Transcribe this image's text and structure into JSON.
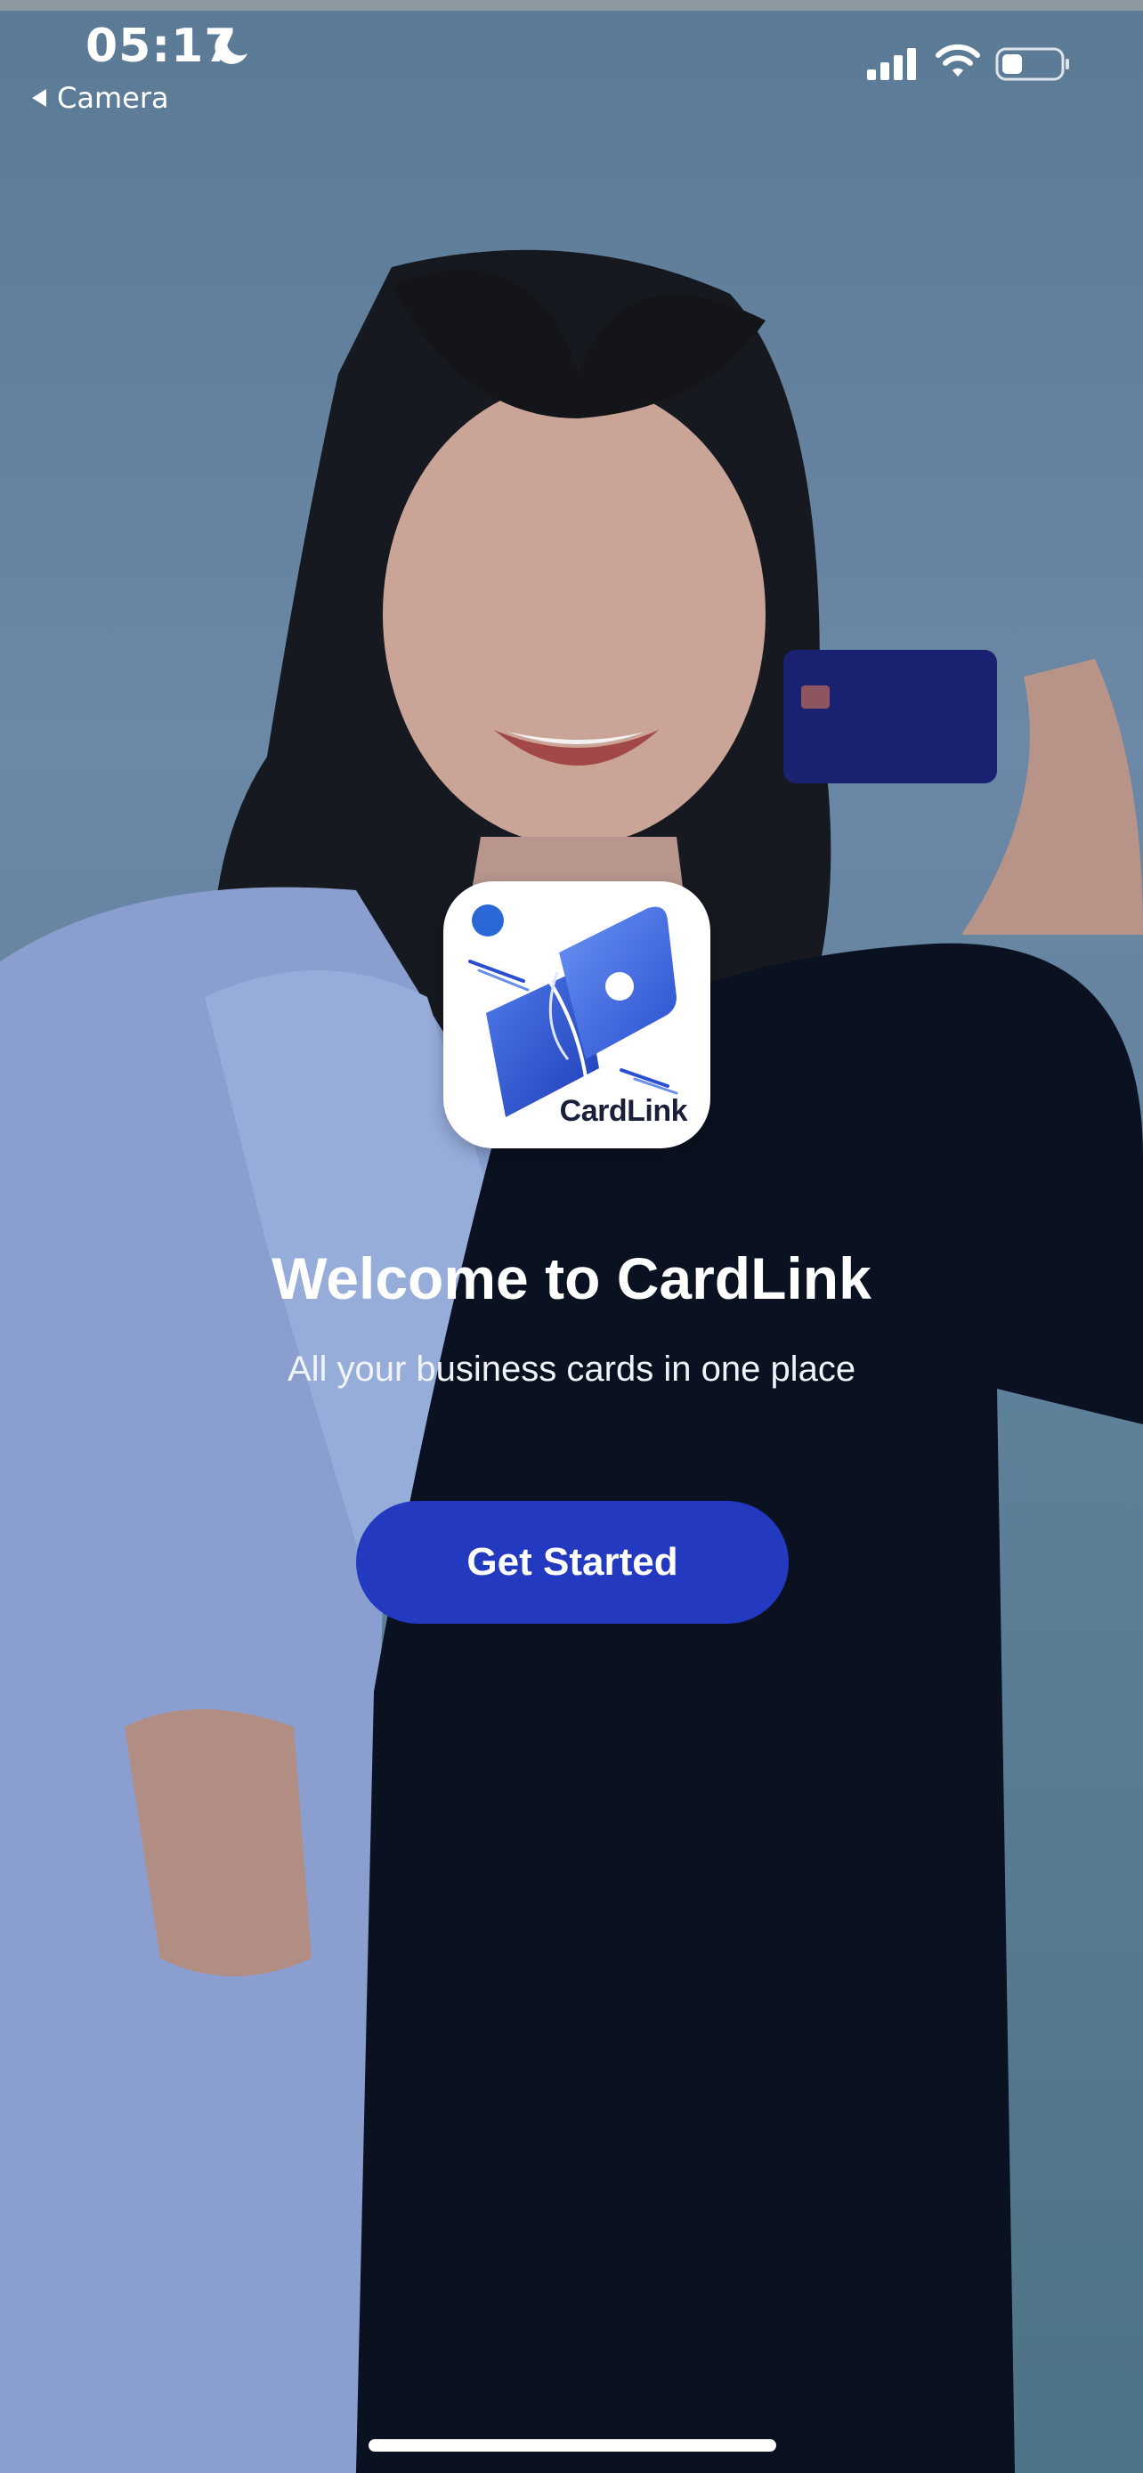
{
  "status_bar": {
    "time": "05:17",
    "back_app": "Camera"
  },
  "icons": {
    "focus": "moon-icon",
    "signal": "cellular-signal-icon",
    "wifi": "wifi-icon",
    "battery": "battery-icon",
    "back": "back-triangle-icon"
  },
  "app_logo": {
    "wordmark": "CardLink"
  },
  "welcome": {
    "title": "Welcome to CardLink",
    "subtitle": "All your business cards in one place"
  },
  "cta": {
    "label": "Get Started"
  },
  "colors": {
    "button": "#2239c0",
    "background": "#5b7a95",
    "text": "#ffffff"
  }
}
